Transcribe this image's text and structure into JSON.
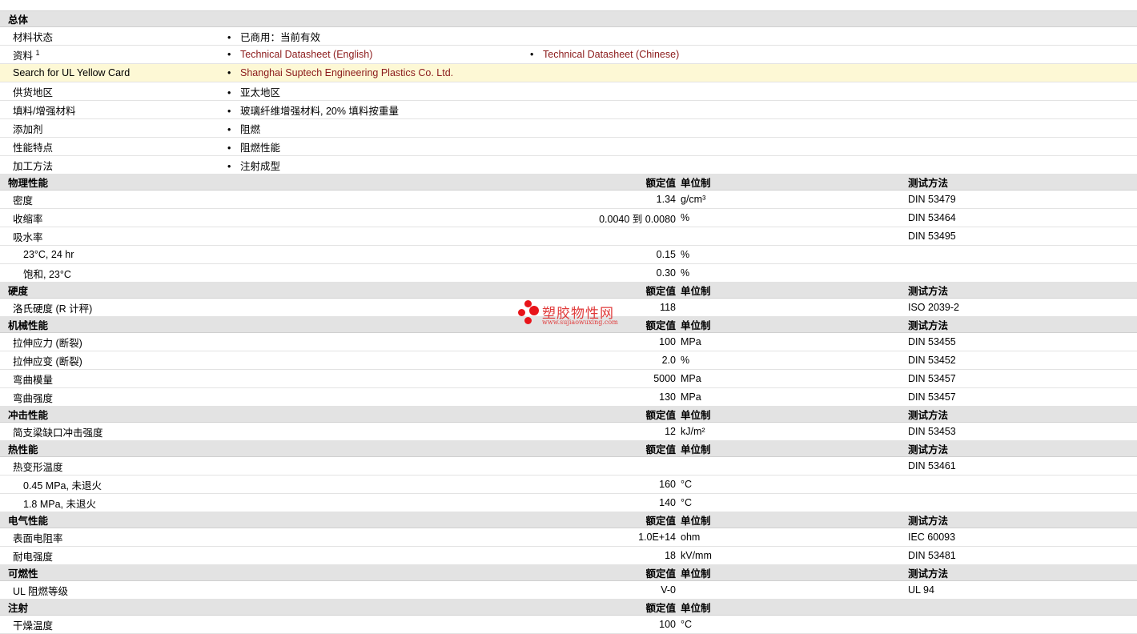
{
  "general": {
    "section_title": "总体",
    "material_status_label": "材料状态",
    "material_status_value": "已商用：当前有效",
    "documents_label": "资料",
    "documents_sup": "1",
    "doc_english": "Technical Datasheet (English)",
    "doc_chinese": "Technical Datasheet (Chinese)",
    "ul_label": "Search for UL Yellow Card",
    "ul_value": "Shanghai Suptech Engineering Plastics Co. Ltd.",
    "region_label": "供货地区",
    "region_value": "亚太地区",
    "filler_label": "填料/增强材料",
    "filler_value": "玻璃纤维增强材料, 20% 填料按重量",
    "additive_label": "添加剂",
    "additive_value": "阻燃",
    "features_label": "性能特点",
    "features_value": "阻燃性能",
    "processing_label": "加工方法",
    "processing_value": "注射成型"
  },
  "headers": {
    "nominal": "额定值",
    "unit": "单位制",
    "test": "测试方法"
  },
  "physical": {
    "title": "物理性能",
    "rows": [
      {
        "label": "密度",
        "value": "1.34",
        "unit": "g/cm³",
        "test": "DIN 53479"
      },
      {
        "label": "收缩率",
        "value": "0.0040 到  0.0080",
        "unit": "%",
        "test": "DIN 53464"
      },
      {
        "label": "吸水率",
        "value": "",
        "unit": "",
        "test": "DIN 53495"
      },
      {
        "label": "23°C, 24 hr",
        "value": "0.15",
        "unit": "%",
        "test": ""
      },
      {
        "label": "饱和, 23°C",
        "value": "0.30",
        "unit": "%",
        "test": ""
      }
    ]
  },
  "hardness": {
    "title": "硬度",
    "rows": [
      {
        "label": "洛氏硬度 (R 计秤)",
        "value": "118",
        "unit": "",
        "test": "ISO 2039-2"
      }
    ]
  },
  "mechanical": {
    "title": "机械性能",
    "rows": [
      {
        "label": "拉伸应力 (断裂)",
        "value": "100",
        "unit": "MPa",
        "test": "DIN 53455"
      },
      {
        "label": "拉伸应变 (断裂)",
        "value": "2.0",
        "unit": "%",
        "test": "DIN 53452"
      },
      {
        "label": "弯曲模量",
        "value": "5000",
        "unit": "MPa",
        "test": "DIN 53457"
      },
      {
        "label": "弯曲强度",
        "value": "130",
        "unit": "MPa",
        "test": "DIN 53457"
      }
    ]
  },
  "impact": {
    "title": "冲击性能",
    "rows": [
      {
        "label": "简支梁缺口冲击强度",
        "value": "12",
        "unit": "kJ/m²",
        "test": "DIN 53453"
      }
    ]
  },
  "thermal": {
    "title": "热性能",
    "rows": [
      {
        "label": "热变形温度",
        "value": "",
        "unit": "",
        "test": "DIN 53461"
      },
      {
        "label": "0.45 MPa, 未退火",
        "value": "160",
        "unit": "°C",
        "test": ""
      },
      {
        "label": "1.8 MPa, 未退火",
        "value": "140",
        "unit": "°C",
        "test": ""
      }
    ]
  },
  "electrical": {
    "title": "电气性能",
    "rows": [
      {
        "label": "表面电阻率",
        "value": "1.0E+14",
        "unit": "ohm",
        "test": "IEC 60093"
      },
      {
        "label": "耐电强度",
        "value": "18",
        "unit": "kV/mm",
        "test": "DIN 53481"
      }
    ]
  },
  "flammability": {
    "title": "可燃性",
    "rows": [
      {
        "label": "UL 阻燃等级",
        "value": "V-0",
        "unit": "",
        "test": "UL 94"
      }
    ]
  },
  "injection": {
    "title": "注射",
    "rows": [
      {
        "label": "干燥温度",
        "value": "100",
        "unit": "°C",
        "test": ""
      }
    ]
  },
  "watermark": {
    "title": "塑胶物性网",
    "url": "www.sujiaowuxing.com",
    "color": "#e8141a"
  }
}
